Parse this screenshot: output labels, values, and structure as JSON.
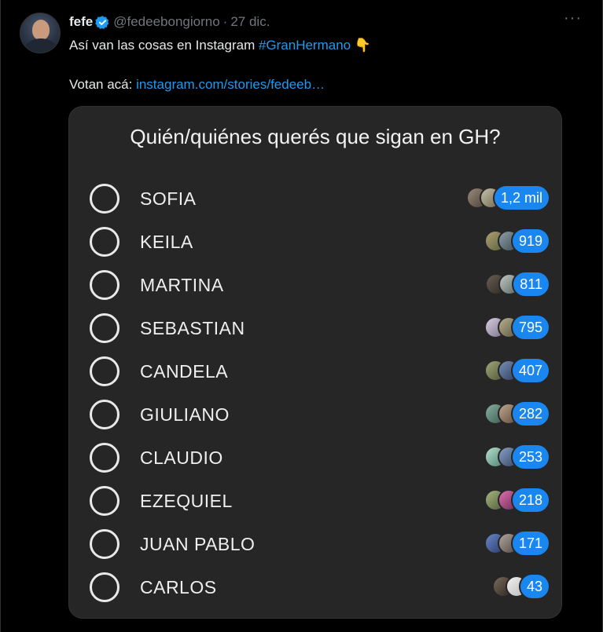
{
  "tweet": {
    "author_name": "fefe",
    "handle": "@fedeebongiorno",
    "date": "27 dic.",
    "more_label": "···",
    "text_prefix": "Así van las cosas en Instagram ",
    "hashtag": "#GranHermano",
    "emoji": "👇",
    "vote_label": "Votan acá:",
    "link_text": "instagram.com/stories/fedeeb…"
  },
  "poll": {
    "title": "Quién/quiénes querés que sigan en GH?",
    "options": [
      {
        "label": "SOFIA",
        "count": "1,2 mil"
      },
      {
        "label": "KEILA",
        "count": "919"
      },
      {
        "label": "MARTINA",
        "count": "811"
      },
      {
        "label": "SEBASTIAN",
        "count": "795"
      },
      {
        "label": "CANDELA",
        "count": "407"
      },
      {
        "label": "GIULIANO",
        "count": "282"
      },
      {
        "label": "CLAUDIO",
        "count": "253"
      },
      {
        "label": "EZEQUIEL",
        "count": "218"
      },
      {
        "label": "JUAN PABLO",
        "count": "171"
      },
      {
        "label": "CARLOS",
        "count": "43"
      }
    ]
  },
  "colors": {
    "background": "#000000",
    "card": "#262626",
    "accent_blue": "#1d9bf0",
    "badge_blue": "#1a86f0"
  }
}
